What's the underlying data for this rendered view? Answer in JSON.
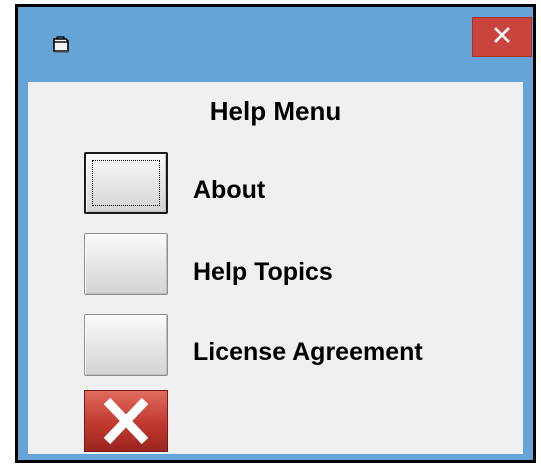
{
  "window": {
    "close_glyph": "✕",
    "icon": "app-window-icon"
  },
  "menu": {
    "title": "Help Menu",
    "items": [
      {
        "label": "About",
        "focused": true
      },
      {
        "label": "Help Topics",
        "focused": false
      },
      {
        "label": "License Agreement",
        "focused": false
      }
    ],
    "exit_icon": "red-x-icon"
  },
  "colors": {
    "titlebar": "#66a4d8",
    "close_button": "#c8443c",
    "client_background": "#f0f0f0",
    "exit_button": "#c0392f"
  }
}
